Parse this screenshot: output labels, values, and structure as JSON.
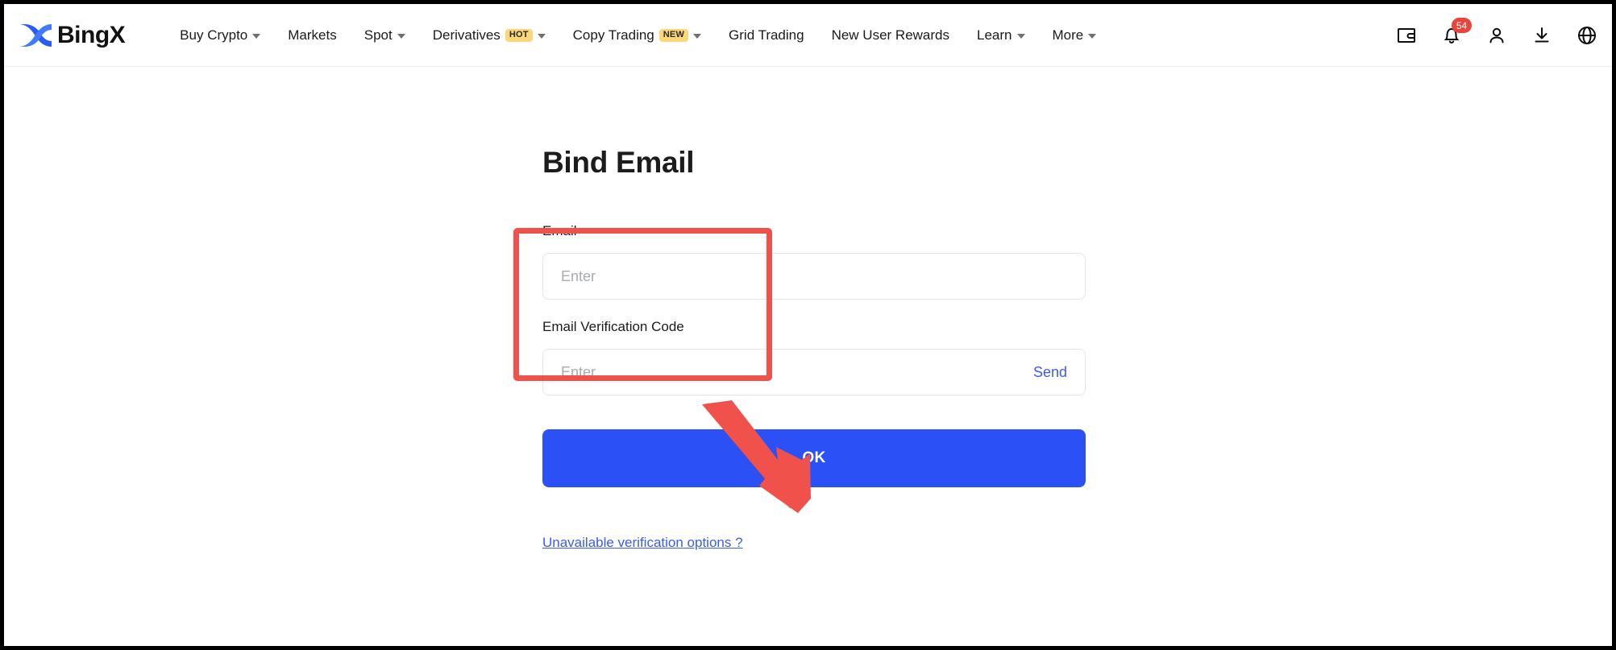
{
  "colors": {
    "brand_blue": "#2B50F5",
    "link_blue": "#3B5BFA",
    "badge_yellow": "#FBD778",
    "notification_red": "#E8443A",
    "annotation_red": "#F0514B",
    "text_dark": "#1b1b1b",
    "placeholder_gray": "#a8abb0",
    "input_border": "#e3e5e8"
  },
  "header": {
    "logo_text": "BingX",
    "logo_icon": "bingx-x-logo",
    "nav": [
      {
        "label": "Buy Crypto",
        "has_caret": true,
        "badge": ""
      },
      {
        "label": "Markets",
        "has_caret": false,
        "badge": ""
      },
      {
        "label": "Spot",
        "has_caret": true,
        "badge": ""
      },
      {
        "label": "Derivatives",
        "has_caret": true,
        "badge": "HOT"
      },
      {
        "label": "Copy Trading",
        "has_caret": true,
        "badge": "NEW"
      },
      {
        "label": "Grid Trading",
        "has_caret": false,
        "badge": ""
      },
      {
        "label": "New User Rewards",
        "has_caret": false,
        "badge": ""
      },
      {
        "label": "Learn",
        "has_caret": true,
        "badge": ""
      },
      {
        "label": "More",
        "has_caret": true,
        "badge": ""
      }
    ],
    "icons": [
      {
        "name": "wallet-icon"
      },
      {
        "name": "bell-icon"
      },
      {
        "name": "user-icon"
      },
      {
        "name": "download-icon"
      },
      {
        "name": "globe-icon"
      }
    ],
    "notification_count": "54"
  },
  "main": {
    "title": "Bind Email",
    "email_field": {
      "label": "Email",
      "placeholder": "Enter",
      "value": ""
    },
    "code_field": {
      "label": "Email Verification Code",
      "placeholder": "Enter",
      "value": "",
      "send_label": "Send"
    },
    "submit_label": "OK",
    "footer_link": "Unavailable verification options ?"
  },
  "annotations": {
    "highlight_box_target": "email-field-group",
    "arrow_target": "ok-button"
  }
}
